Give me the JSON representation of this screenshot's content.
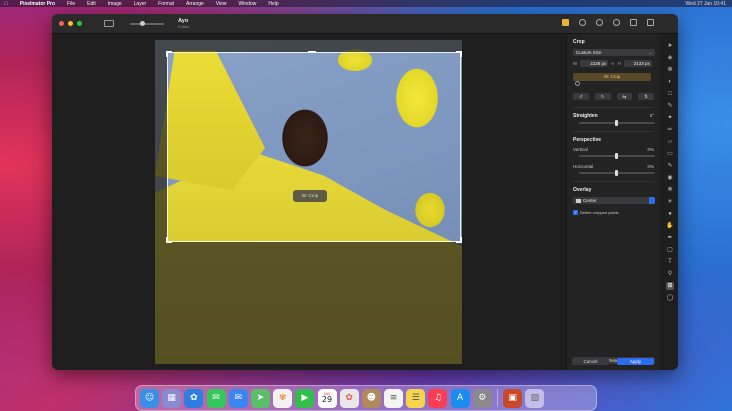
{
  "menubar": {
    "app": "Pixelmator Pro",
    "items": [
      "File",
      "Edit",
      "Image",
      "Layer",
      "Format",
      "Arrange",
      "View",
      "Window",
      "Help"
    ],
    "right": "Wed 27 Jan 10:41"
  },
  "titlebar": {
    "title": "Ayo",
    "subtitle": "Edited"
  },
  "canvas": {
    "crop_badge": "W: Crop"
  },
  "inspector": {
    "section_crop": "Crop",
    "preset": "Custom Size",
    "width_label": "W",
    "width_value": "2236 px",
    "height_label": "H",
    "height_value": "2133 px",
    "apply_crop_label": "W: Crop",
    "section_straighten": "Straighten",
    "straighten_value": "0°",
    "section_perspective": "Perspective",
    "vertical_label": "Vertical",
    "vertical_value": "0%",
    "horizontal_label": "Horizontal",
    "horizontal_value": "0%",
    "section_overlay": "Overlay",
    "overlay_value": "Center",
    "delete_cropped_label": "Delete cropped pixels",
    "delete_cropped_checked": true,
    "reset_label": "Reset",
    "cancel_label": "Cancel",
    "apply_label": "Apply"
  },
  "dock": {
    "calendar_month": "JAN",
    "calendar_day": "29",
    "icons": [
      "finder-icon",
      "launchpad-icon",
      "safari-icon",
      "messages-icon",
      "mail-icon",
      "maps-icon",
      "photos-icon",
      "facetime-icon",
      "calendar-icon",
      "pixelmator-icon",
      "contacts-icon",
      "reminders-icon",
      "notes-icon",
      "music-icon",
      "app-store-icon",
      "system-preferences-icon",
      "photo-thumbnail-icon",
      "trash-icon"
    ],
    "colors": {
      "finder": "#3a8ee8",
      "launchpad": "#8a8ad0",
      "safari": "#2e7de0",
      "messages": "#34c759",
      "mail": "#3a86f0",
      "maps": "#5bbf6a",
      "photos": "#f2f2f2",
      "facetime": "#2fbf4a",
      "pixelmator": "#e8e8e8",
      "contacts": "#b08a5a",
      "reminders": "#f4f4f4",
      "notes": "#f6d54a",
      "music": "#fb3c55",
      "app_store": "#1a8cf0",
      "system_preferences": "#8a8a8e"
    }
  },
  "colors": {
    "accent_blue": "#2a6ef0",
    "apply_crop_bg": "#5a4a2a"
  }
}
